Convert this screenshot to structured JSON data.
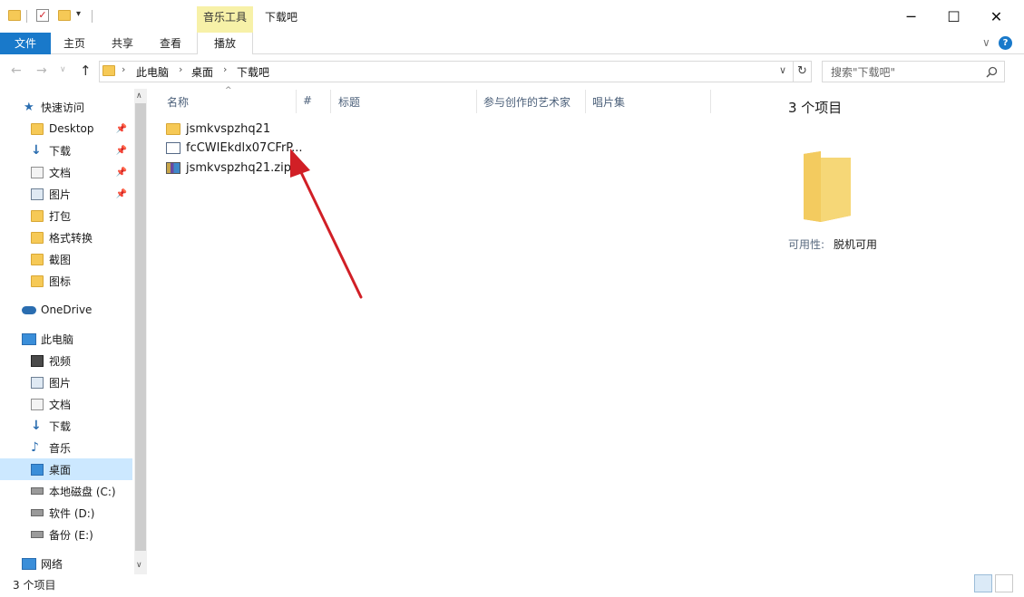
{
  "window": {
    "title": "下载吧",
    "context_tab_group": "音乐工具",
    "minimize_glyph": "─",
    "maximize_glyph": "☐",
    "close_glyph": "✕"
  },
  "ribbon": {
    "tabs": [
      "文件",
      "主页",
      "共享",
      "查看",
      "播放"
    ],
    "expand_glyph": "∨",
    "help_glyph": "?"
  },
  "address": {
    "breadcrumbs": [
      "此电脑",
      "桌面",
      "下载吧"
    ],
    "dropdown_glyph": "∨",
    "refresh_glyph": "↻",
    "search_placeholder": "搜索\"下载吧\""
  },
  "nav_pane": {
    "quick_access": {
      "label": "快速访问",
      "items": [
        {
          "label": "Desktop",
          "icon": "folder-icon",
          "pinned": true
        },
        {
          "label": "下载",
          "icon": "download-arrow-icon",
          "pinned": true
        },
        {
          "label": "文档",
          "icon": "document-icon",
          "pinned": true
        },
        {
          "label": "图片",
          "icon": "picture-icon",
          "pinned": true
        },
        {
          "label": "打包",
          "icon": "folder-icon",
          "pinned": false
        },
        {
          "label": "格式转换",
          "icon": "folder-icon",
          "pinned": false
        },
        {
          "label": "截图",
          "icon": "folder-icon",
          "pinned": false
        },
        {
          "label": "图标",
          "icon": "folder-icon",
          "pinned": false
        }
      ]
    },
    "onedrive": {
      "label": "OneDrive"
    },
    "this_pc": {
      "label": "此电脑",
      "items": [
        {
          "label": "视频",
          "icon": "film-icon"
        },
        {
          "label": "图片",
          "icon": "picture-icon"
        },
        {
          "label": "文档",
          "icon": "document-icon"
        },
        {
          "label": "下载",
          "icon": "download-arrow-icon"
        },
        {
          "label": "音乐",
          "icon": "music-note-icon"
        },
        {
          "label": "桌面",
          "icon": "desktop-icon",
          "selected": true
        },
        {
          "label": "本地磁盘 (C:)",
          "icon": "drive-icon"
        },
        {
          "label": "软件 (D:)",
          "icon": "drive-icon"
        },
        {
          "label": "备份 (E:)",
          "icon": "drive-icon"
        }
      ]
    },
    "network": {
      "label": "网络"
    }
  },
  "columns": [
    "名称",
    "#",
    "标题",
    "参与创作的艺术家",
    "唱片集"
  ],
  "files": [
    {
      "name": "jsmkvspzhq21",
      "icon": "folder-icon"
    },
    {
      "name": "fcCWIEkdlx07CFrP...",
      "icon": "media-file-icon"
    },
    {
      "name": "jsmkvspzhq21.zip",
      "icon": "zip-archive-icon"
    }
  ],
  "details": {
    "count_text": "3 个项目",
    "availability_label": "可用性:",
    "availability_value": "脱机可用"
  },
  "status": {
    "item_count": "3 个项目"
  },
  "colors": {
    "accent": "#1979ca",
    "context_tab": "#f7f1a8",
    "selection": "#cce8ff",
    "arrow": "#d11f26"
  }
}
